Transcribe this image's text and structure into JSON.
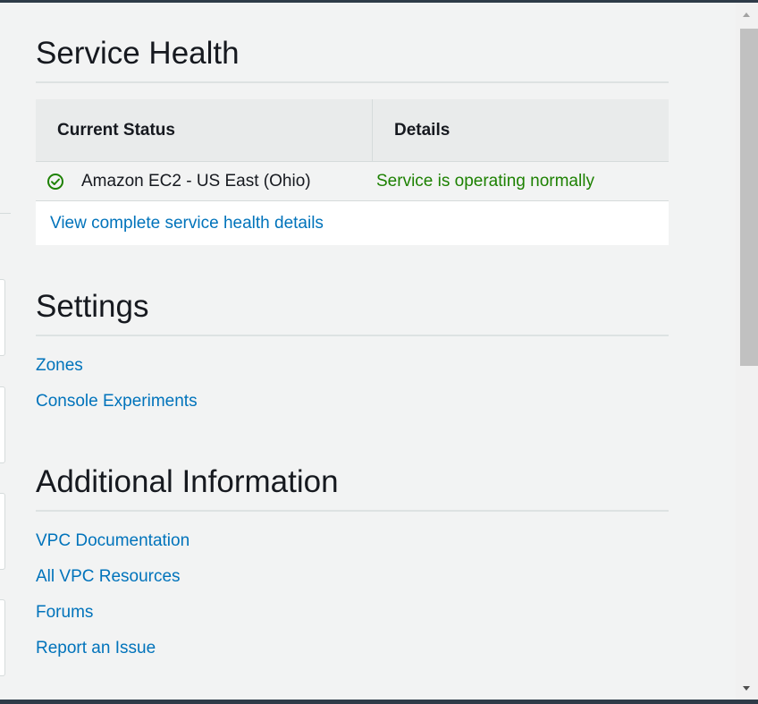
{
  "service_health": {
    "title": "Service Health",
    "columns": [
      "Current Status",
      "Details"
    ],
    "rows": [
      {
        "region": "Amazon EC2 - US East (Ohio)",
        "status": "Service is operating normally",
        "status_icon": "check-circle-icon"
      }
    ],
    "details_link": "View complete service health details"
  },
  "settings": {
    "title": "Settings",
    "links": [
      "Zones",
      "Console Experiments"
    ]
  },
  "additional_info": {
    "title": "Additional Information",
    "links": [
      "VPC Documentation",
      "All VPC Resources",
      "Forums",
      "Report an Issue"
    ]
  },
  "colors": {
    "link": "#0073bb",
    "success": "#1d8102",
    "background": "#f2f3f3",
    "table_header": "#e9ebeb",
    "frame": "#2e3b48"
  }
}
